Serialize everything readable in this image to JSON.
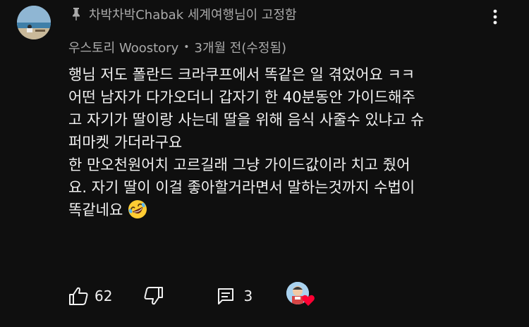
{
  "pinned": {
    "icon": "pin-icon",
    "text": "차박차박Chabak 세계여행님이 고정함"
  },
  "author": {
    "name": "우스토리 Woostory",
    "separator": "•",
    "time": "3개월 전(수정됨)",
    "avatar": "avatar"
  },
  "more_icon": "vertical-dots-icon",
  "comment": {
    "lines": [
      "행님 저도 폴란드 크라쿠프에서 똑같은 일 겪었어요 ㅋㅋ",
      "어떤 남자가 다가오더니 갑자기 한 40분동안 가이드해주",
      "고 자기가 딸이랑 사는데 딸을 위해 음식 사줄수 있냐고 슈",
      "퍼마켓 가더라구요",
      "한 만오천원어치 고르길래 그냥 가이드값이라 치고 줬어",
      "요. 자기 딸이 이걸 좋아할거라면서 말하는것까지 수법이",
      "똑같네요"
    ],
    "emoji": "rolling-on-floor-laughing-emoji"
  },
  "actions": {
    "like_icon": "thumbs-up-icon",
    "like_count": "62",
    "dislike_icon": "thumbs-down-icon",
    "reply_icon": "reply-comment-icon",
    "reply_count": "3",
    "creator_heart_icon": "heart-icon",
    "heart_color": "#ff0033"
  }
}
